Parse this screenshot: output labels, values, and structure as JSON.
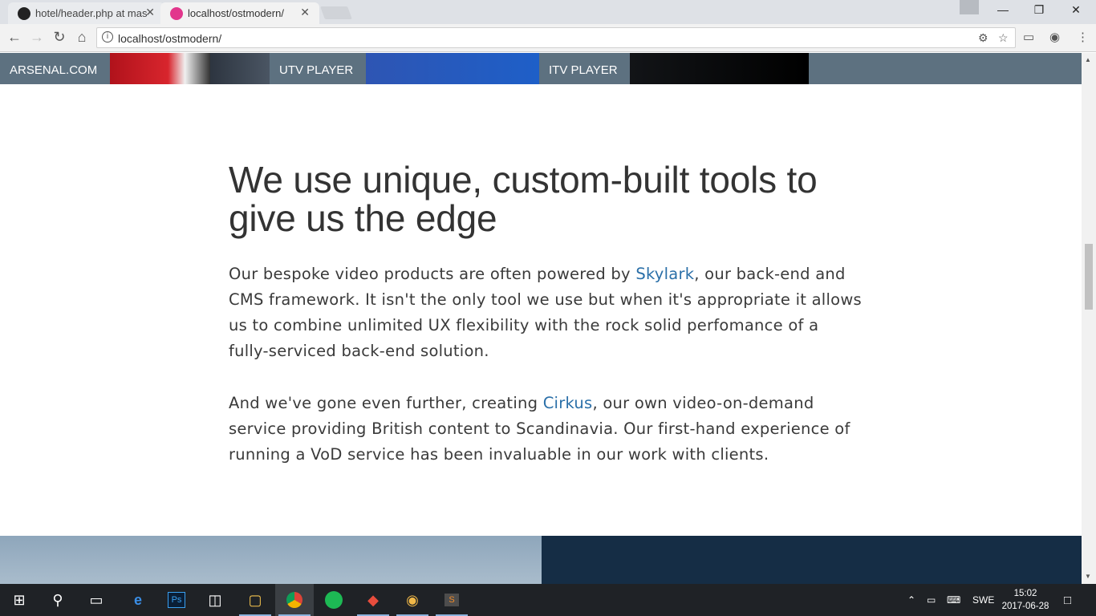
{
  "browser": {
    "tabs": [
      {
        "title": "hotel/header.php at mas",
        "active": false
      },
      {
        "title": "localhost/ostmodern/",
        "active": true
      }
    ],
    "url": "localhost/ostmodern/",
    "close_glyph": "✕"
  },
  "strip": {
    "items": [
      "ARSENAL.COM",
      "UTV PLAYER",
      "ITV PLAYER"
    ]
  },
  "article": {
    "heading": "We use unique, custom-built tools to give us the edge",
    "para1_before": "Our bespoke video products are often powered by ",
    "para1_link": "Skylark",
    "para1_after": ", our back-end and CMS framework. It isn't the only tool we use but when it's appropriate it allows us to combine unlimited UX flexibility with the rock solid perfomance of a fully-serviced back-end solution.",
    "para2_before": "And we've gone even further, creating ",
    "para2_link": "Cirkus",
    "para2_after": ", our own video-on-demand service providing British content to Scandinavia. Our first-hand experience of running a VoD service has been invaluable in our work with clients.",
    "link_color": "#2a6fa8"
  },
  "taskbar": {
    "apps": [
      "start-icon",
      "search-icon",
      "task-view-icon",
      "edge-icon",
      "photoshop-icon",
      "store-icon",
      "file-explorer-icon",
      "chrome-icon",
      "spotify-icon",
      "git-icon",
      "paint-icon",
      "sublime-icon"
    ],
    "language": "SWE",
    "time": "15:02",
    "date": "2017-06-28"
  }
}
